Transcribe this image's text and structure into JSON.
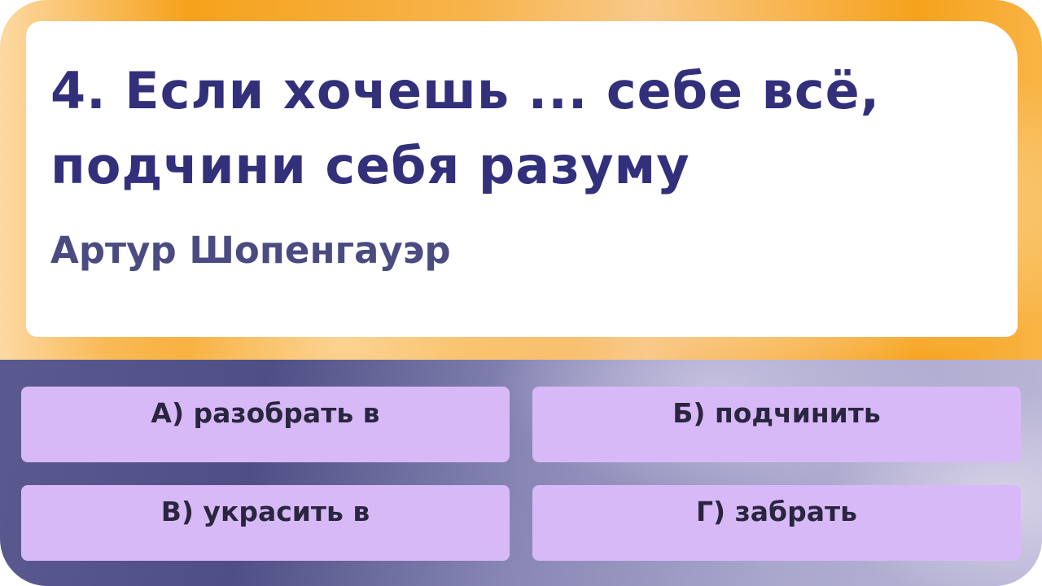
{
  "question": {
    "number": "4.",
    "line1": "Если хочешь ... себе всё,",
    "line2": "подчини себя разуму",
    "author": "Артур Шопенгауэр"
  },
  "options": [
    {
      "letter": "А)",
      "text": "разобрать в",
      "label": "А) разобрать в"
    },
    {
      "letter": "Б)",
      "text": "подчинить",
      "label": "Б) подчинить"
    },
    {
      "letter": "В)",
      "text": "украсить в",
      "label": "В) украсить в"
    },
    {
      "letter": "Г)",
      "text": "забрать",
      "label": "Г) забрать"
    }
  ],
  "colors": {
    "accent_orange": "#f6a21c",
    "question_text": "#33307b",
    "author_text": "#4a4b80",
    "option_bg": "#d8b9f7",
    "option_text": "#2a2640",
    "bottom_band": "#5a5990"
  }
}
